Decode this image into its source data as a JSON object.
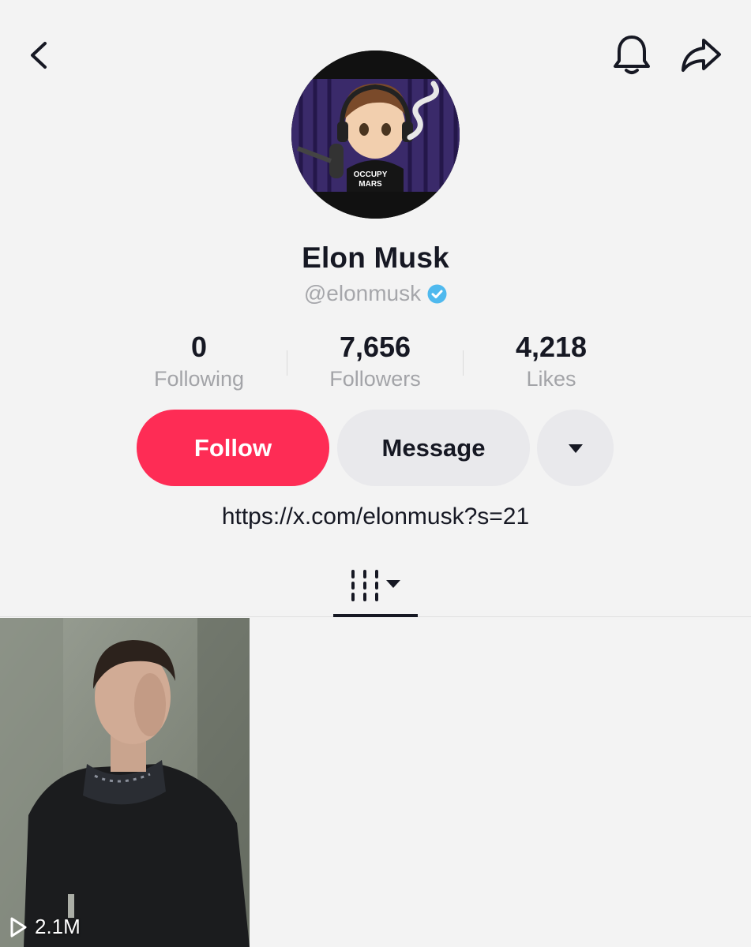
{
  "profile": {
    "name": "Elon Musk",
    "handle": "@elonmusk",
    "bio_link": "https://x.com/elonmusk?s=21",
    "avatar_shirt_text_line1": "OCCUPY",
    "avatar_shirt_text_line2": "MARS"
  },
  "stats": [
    {
      "value": "0",
      "label": "Following"
    },
    {
      "value": "7,656",
      "label": "Followers"
    },
    {
      "value": "4,218",
      "label": "Likes"
    }
  ],
  "actions": {
    "follow_label": "Follow",
    "message_label": "Message"
  },
  "videos": [
    {
      "views": "2.1M"
    }
  ],
  "colors": {
    "accent": "#fe2c55",
    "verified": "#20d5ec",
    "secondary_text": "#a6a7ab"
  },
  "icons": {
    "back": "chevron-left-icon",
    "bell": "bell-icon",
    "share": "share-arrow-icon",
    "verified": "verified-badge-icon",
    "more": "caret-down-icon",
    "grid_tab": "video-grid-icon",
    "play": "play-icon"
  }
}
